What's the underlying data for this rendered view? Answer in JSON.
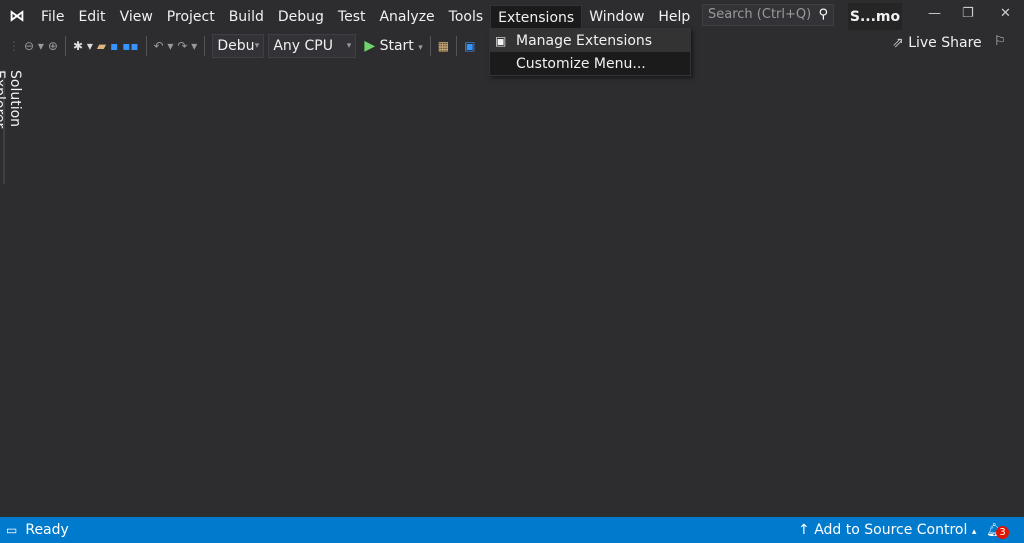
{
  "menubar": {
    "items": [
      "File",
      "Edit",
      "View",
      "Project",
      "Build",
      "Debug",
      "Test",
      "Analyze",
      "Tools",
      "Extensions",
      "Window",
      "Help"
    ],
    "search_placeholder": "Search (Ctrl+Q)",
    "solution_name": "S...mo"
  },
  "toolbar": {
    "configuration": "Debu",
    "platform": "Any CPU",
    "start_label": "Start",
    "live_share": "Live Share"
  },
  "extensions_menu": {
    "items": [
      "Manage Extensions",
      "Customize Menu..."
    ]
  },
  "side_tab": "Solution Explorer",
  "status": {
    "text": "Ready",
    "source_control": "Add to Source Control",
    "notifications": "3"
  },
  "colors": {
    "background": "#2d2d30",
    "status_bar": "#007acc",
    "accent": "#3794ff"
  }
}
